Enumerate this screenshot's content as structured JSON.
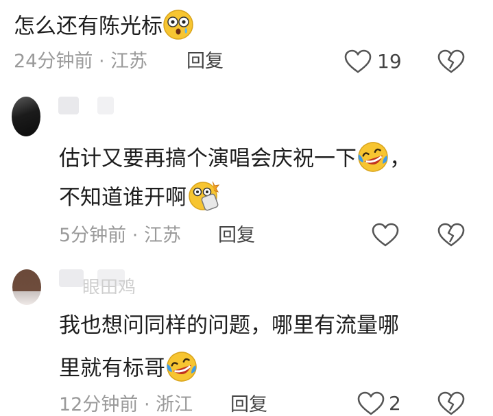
{
  "comments": [
    {
      "lines": [
        "怎么还有陈光标"
      ],
      "emoji": [
        "shocked-face-icon"
      ],
      "time": "24分钟前",
      "sep": "·",
      "location": "江苏",
      "reply_label": "回复",
      "likes": "19"
    },
    {
      "lines": [
        "估计又要再搞个演唱会庆祝一下",
        "不知道谁开啊"
      ],
      "line1_suffix": "，",
      "emoji": [
        "laughing-crying-face-icon",
        "shocked-money-face-icon"
      ],
      "time": "5分钟前",
      "sep": "·",
      "location": "江苏",
      "reply_label": "回复",
      "likes": ""
    },
    {
      "username_partial": "眼田鸡",
      "lines": [
        "我也想问同样的问题，哪里有流量哪",
        "里就有标哥"
      ],
      "emoji": [
        "laughing-crying-face-icon"
      ],
      "time": "12分钟前",
      "sep": "·",
      "location": "浙江",
      "reply_label": "回复",
      "likes": "2"
    }
  ],
  "colors": {
    "text": "#1d1d1d",
    "meta": "#9a9a9a",
    "icon_stroke": "#555555",
    "emoji_yellow": "#f7c531"
  }
}
